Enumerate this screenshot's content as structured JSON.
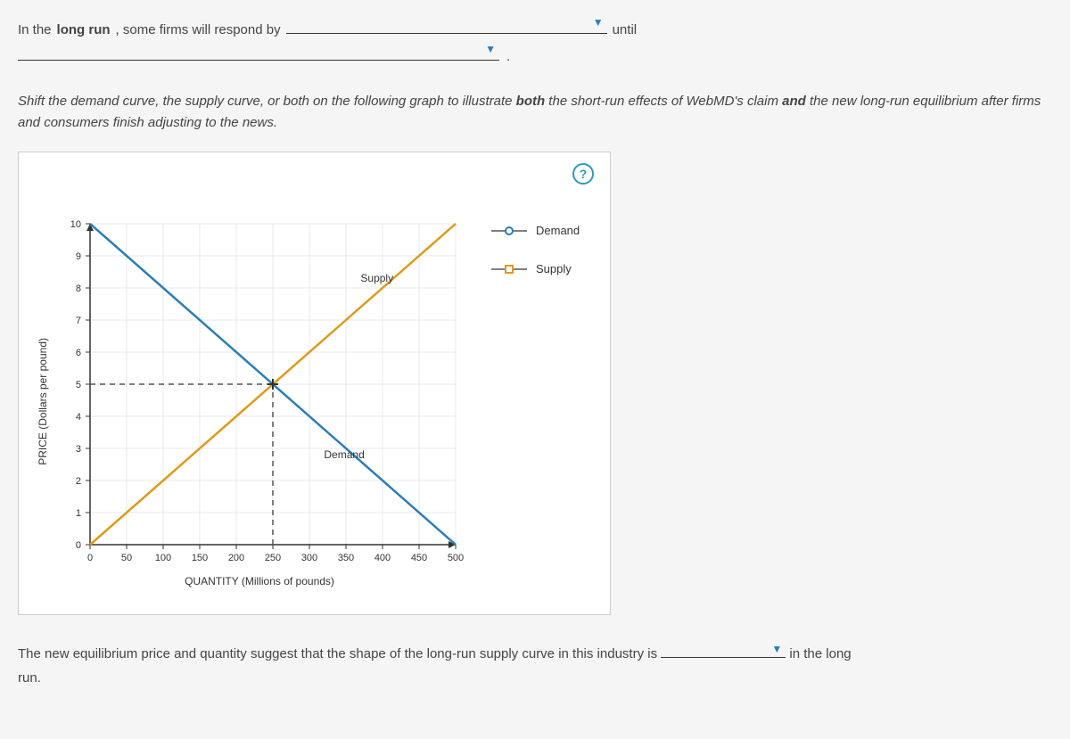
{
  "question1": {
    "prefix": "In the",
    "bold": "long run",
    "mid": ", some firms will respond by",
    "until": "until"
  },
  "instruction": {
    "p1": "Shift the demand curve, the supply curve, or both on the following graph to illustrate ",
    "b1": "both",
    "p2": " the short-run effects of WebMD's claim ",
    "b2": "and",
    "p3": " the new long-run equilibrium after firms and consumers finish adjusting to the news."
  },
  "help_label": "?",
  "chart_data": {
    "type": "line",
    "xlabel": "QUANTITY (Millions of pounds)",
    "ylabel": "PRICE (Dollars per pound)",
    "xlim": [
      0,
      500
    ],
    "ylim": [
      0,
      10
    ],
    "xticks": [
      0,
      50,
      100,
      150,
      200,
      250,
      300,
      350,
      400,
      450,
      500
    ],
    "yticks": [
      0,
      1,
      2,
      3,
      4,
      5,
      6,
      7,
      8,
      9,
      10
    ],
    "series": [
      {
        "name": "Demand",
        "color": "#2a7db8",
        "points": [
          [
            0,
            10
          ],
          [
            500,
            0
          ]
        ],
        "label_pos": [
          320,
          2.7
        ],
        "marker": "circle"
      },
      {
        "name": "Supply",
        "color": "#e09a1a",
        "points": [
          [
            0,
            0
          ],
          [
            500,
            10
          ]
        ],
        "label_pos": [
          370,
          8.2
        ],
        "marker": "square"
      }
    ],
    "equilibrium": {
      "x": 250,
      "y": 5
    },
    "guides": [
      {
        "type": "h",
        "y": 5,
        "x0": 0,
        "x1": 250
      },
      {
        "type": "v",
        "x": 250,
        "y0": 0,
        "y1": 5
      }
    ]
  },
  "legend": {
    "demand": "Demand",
    "supply": "Supply"
  },
  "conclusion": {
    "p1": "The new equilibrium price and quantity suggest that the shape of the long-run supply curve in this industry is",
    "p2": "in the long",
    "p3": "run."
  }
}
